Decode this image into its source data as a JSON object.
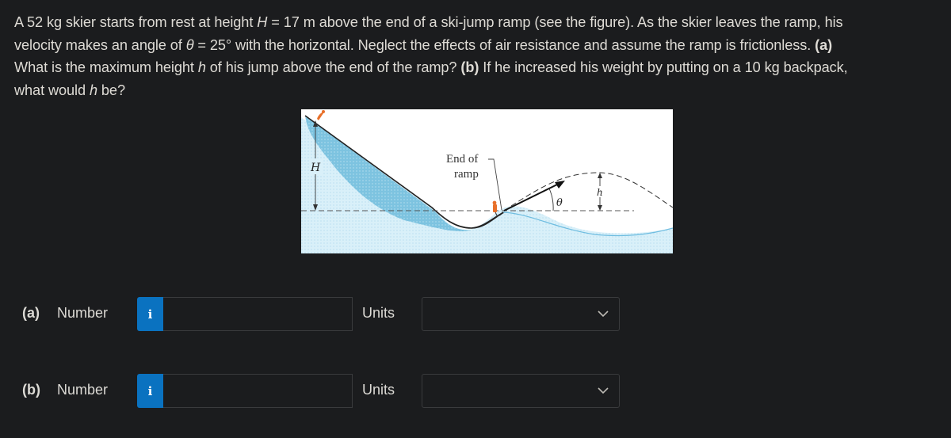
{
  "problem": {
    "line1": [
      "A 52 kg skier starts from rest at height ",
      "H",
      " = 17 m above the end of a ski-jump ramp (see the figure). As the skier leaves the ramp, his"
    ],
    "line2": [
      "velocity makes an angle of ",
      "θ",
      " = 25° with the horizontal. Neglect the effects of air resistance and assume the ramp is frictionless. ",
      "(a)"
    ],
    "line3": [
      "What is the maximum height ",
      "h",
      " of his jump above the end of the ramp? ",
      "(b)",
      " If he increased his weight by putting on a 10 kg backpack,"
    ],
    "line4": [
      "what would ",
      "h",
      " be?"
    ]
  },
  "figure": {
    "label_H": "H",
    "label_end_of": "End of",
    "label_ramp": "ramp",
    "label_theta": "θ",
    "label_h": "h",
    "colors": {
      "snow_dark": "#7cc4e0",
      "snow_light": "#d6eef8",
      "skier": "#e8702a"
    }
  },
  "answers": [
    {
      "part": "(a)",
      "number_label": "Number",
      "info_icon": "i",
      "value": "",
      "units_label": "Units",
      "units_selected": ""
    },
    {
      "part": "(b)",
      "number_label": "Number",
      "info_icon": "i",
      "value": "",
      "units_label": "Units",
      "units_selected": ""
    }
  ],
  "colors": {
    "background": "#1b1c1e",
    "text": "#dcdad5",
    "info_button": "#0a72c0",
    "border": "#3a3b3d"
  }
}
